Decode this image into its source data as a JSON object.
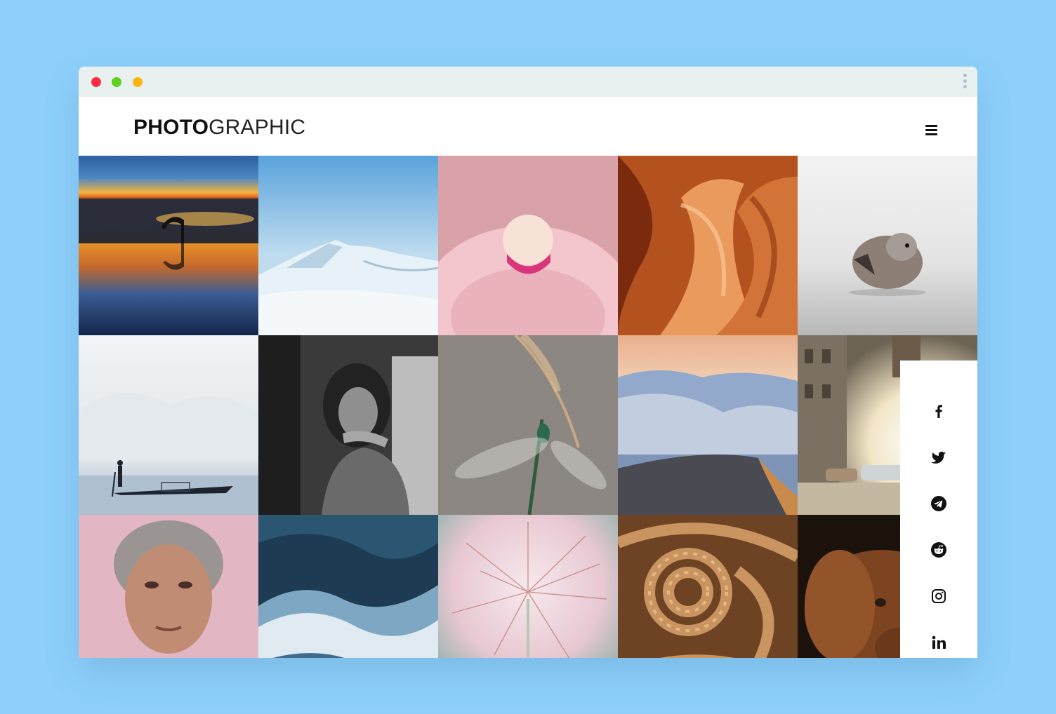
{
  "window": {
    "controls": [
      "close",
      "minimize",
      "maximize"
    ]
  },
  "header": {
    "logo_bold": "PHOTO",
    "logo_light": "GRAPHIC",
    "menu_icon": "hamburger-menu-icon"
  },
  "gallery": {
    "photos": [
      "sunset-yoga-reflection",
      "snowy-mountains",
      "pink-flamingo",
      "sandstone-canyon",
      "small-bird",
      "foggy-lake-boatman",
      "girl-black-and-white",
      "dragonfly",
      "sea-of-clouds-road",
      "sunlit-street-old-cars",
      "elderly-woman-portrait",
      "ocean-waves",
      "dandelion-closeup",
      "coiled-rope",
      "brown-dog"
    ]
  },
  "social": {
    "icons": [
      "facebook-icon",
      "twitter-icon",
      "telegram-icon",
      "reddit-icon",
      "instagram-icon",
      "linkedin-icon"
    ]
  },
  "colors": {
    "background": "#8ed0fb",
    "titlebar": "#e9f0f0",
    "close": "#fe2d3f",
    "minimize": "#5fd11f",
    "maximize": "#fcb613"
  }
}
